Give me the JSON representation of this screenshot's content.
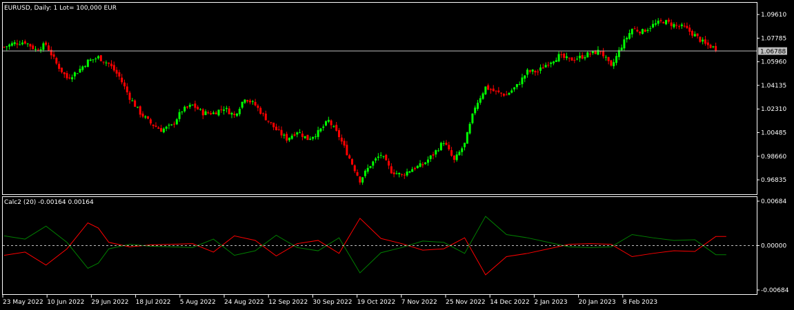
{
  "main_panel": {
    "title": "EURUSD, Daily:  1 Lot= 100,000 EUR",
    "price_line": {
      "value": 1.06788,
      "label": "1.06788",
      "color": "#c0c0c0"
    },
    "y_ticks": [
      "1.09610",
      "1.07785",
      "1.05960",
      "1.04135",
      "1.02310",
      "1.00485",
      "0.98660",
      "0.96835"
    ],
    "colors": {
      "up": "#00ff00",
      "down": "#ff0000",
      "wick": "#00ff00"
    }
  },
  "sub_panel": {
    "title": "Calc2 (20) -0.00164 0.00164",
    "y_ticks": [
      "0.00684",
      "0.00000",
      "-0.00684"
    ],
    "colors": {
      "line_a": "#ff0000",
      "line_b": "#008000",
      "zero": "#c0c0c0"
    }
  },
  "x_ticks": [
    "23 May 2022",
    "10 Jun 2022",
    "29 Jun 2022",
    "18 Jul 2022",
    "5 Aug 2022",
    "24 Aug 2022",
    "12 Sep 2022",
    "30 Sep 2022",
    "19 Oct 2022",
    "7 Nov 2022",
    "25 Nov 2022",
    "14 Dec 2022",
    "2 Jan 2023",
    "20 Jan 2023",
    "8 Feb 2023"
  ],
  "chart_data": [
    {
      "type": "candlestick",
      "title": "EURUSD, Daily:  1 Lot= 100,000 EUR",
      "ylim": [
        0.9572,
        1.1052
      ],
      "ohlc_close_path": [
        [
          0,
          1.071
        ],
        [
          4,
          1.074
        ],
        [
          8,
          1.075
        ],
        [
          12,
          1.069
        ],
        [
          16,
          1.073
        ],
        [
          20,
          1.058
        ],
        [
          24,
          1.047
        ],
        [
          28,
          1.052
        ],
        [
          32,
          1.06
        ],
        [
          36,
          1.063
        ],
        [
          40,
          1.058
        ],
        [
          44,
          1.048
        ],
        [
          48,
          1.032
        ],
        [
          52,
          1.02
        ],
        [
          56,
          1.012
        ],
        [
          60,
          1.007
        ],
        [
          64,
          1.01
        ],
        [
          68,
          1.022
        ],
        [
          72,
          1.026
        ],
        [
          76,
          1.02
        ],
        [
          80,
          1.02
        ],
        [
          84,
          1.024
        ],
        [
          88,
          1.018
        ],
        [
          92,
          1.032
        ],
        [
          96,
          1.026
        ],
        [
          100,
          1.016
        ],
        [
          104,
          1.007
        ],
        [
          108,
          1.0
        ],
        [
          112,
          1.006
        ],
        [
          116,
          1.0
        ],
        [
          120,
          1.005
        ],
        [
          124,
          1.014
        ],
        [
          128,
          1.002
        ],
        [
          132,
          0.985
        ],
        [
          136,
          0.968
        ],
        [
          140,
          0.98
        ],
        [
          144,
          0.988
        ],
        [
          148,
          0.975
        ],
        [
          152,
          0.972
        ],
        [
          156,
          0.977
        ],
        [
          160,
          0.98
        ],
        [
          164,
          0.988
        ],
        [
          168,
          0.998
        ],
        [
          172,
          0.983
        ],
        [
          176,
          0.996
        ],
        [
          180,
          1.025
        ],
        [
          184,
          1.04
        ],
        [
          188,
          1.036
        ],
        [
          192,
          1.034
        ],
        [
          196,
          1.041
        ],
        [
          200,
          1.052
        ],
        [
          204,
          1.052
        ],
        [
          208,
          1.059
        ],
        [
          212,
          1.064
        ],
        [
          216,
          1.061
        ],
        [
          220,
          1.063
        ],
        [
          224,
          1.066
        ],
        [
          228,
          1.068
        ],
        [
          232,
          1.055
        ],
        [
          236,
          1.072
        ],
        [
          240,
          1.085
        ],
        [
          244,
          1.083
        ],
        [
          248,
          1.088
        ],
        [
          252,
          1.091
        ],
        [
          256,
          1.088
        ],
        [
          260,
          1.086
        ],
        [
          264,
          1.08
        ],
        [
          268,
          1.073
        ],
        [
          272,
          1.07
        ]
      ]
    },
    {
      "type": "line",
      "title": "Calc2 (20) -0.00164 0.00164",
      "ylim": [
        -0.00684,
        0.00684
      ],
      "series": [
        {
          "color": "#ff0000",
          "x": [
            0,
            8,
            16,
            24,
            32,
            36,
            40,
            48,
            56,
            64,
            72,
            80,
            88,
            96,
            104,
            112,
            120,
            128,
            136,
            144,
            152,
            160,
            168,
            176,
            184,
            192,
            200,
            208,
            216,
            224,
            232,
            240,
            248,
            256,
            264,
            272,
            276
          ],
          "values": [
            -0.0015,
            -0.001,
            -0.003,
            -0.0005,
            0.0035,
            0.0027,
            0.0005,
            -0.0002,
            0.0001,
            0.0002,
            0.0003,
            -0.001,
            0.0015,
            0.0008,
            -0.0016,
            0.0003,
            0.0008,
            -0.0012,
            0.0042,
            0.0011,
            0.0003,
            -0.0007,
            -0.0005,
            0.0012,
            -0.0045,
            -0.0017,
            -0.0012,
            -0.0005,
            0.0002,
            0.0003,
            0.0002,
            -0.0017,
            -0.0012,
            -0.0008,
            -0.0009,
            0.0014,
            0.0014
          ]
        },
        {
          "color": "#008000",
          "x": [
            0,
            8,
            16,
            24,
            32,
            36,
            40,
            48,
            56,
            64,
            72,
            80,
            88,
            96,
            104,
            112,
            120,
            128,
            136,
            144,
            152,
            160,
            168,
            176,
            184,
            192,
            200,
            208,
            216,
            224,
            232,
            240,
            248,
            256,
            264,
            272,
            276
          ],
          "values": [
            0.0015,
            0.001,
            0.003,
            0.0005,
            -0.0035,
            -0.0027,
            -0.0005,
            0.0002,
            -0.0001,
            -0.0002,
            -0.0003,
            0.001,
            -0.0015,
            -0.0008,
            0.0016,
            -0.0003,
            -0.0008,
            0.0012,
            -0.0042,
            -0.0011,
            -0.0003,
            0.0007,
            0.0005,
            -0.0012,
            0.0045,
            0.0017,
            0.0012,
            0.0005,
            -0.0002,
            -0.0003,
            -0.0002,
            0.0017,
            0.0012,
            0.0008,
            0.0009,
            -0.0014,
            -0.0014
          ]
        }
      ]
    }
  ]
}
